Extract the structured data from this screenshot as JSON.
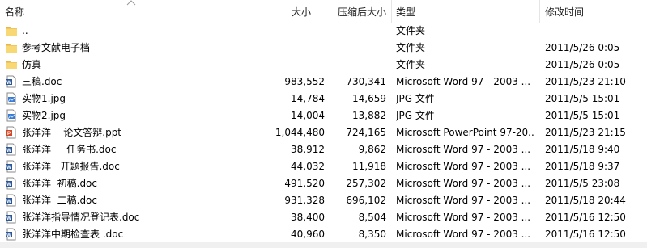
{
  "header": {
    "name": "名称",
    "size": "大小",
    "compressed_size": "压缩后大小",
    "type": "类型",
    "modified": "修改时间"
  },
  "files": [
    {
      "icon": "parent-folder-icon",
      "name": "..",
      "size": "",
      "compressed_size": "",
      "type": "文件夹",
      "modified": ""
    },
    {
      "icon": "folder-icon",
      "name": "参考文献电子档",
      "size": "",
      "compressed_size": "",
      "type": "文件夹",
      "modified": "2011/5/26 0:05"
    },
    {
      "icon": "folder-icon",
      "name": "仿真",
      "size": "",
      "compressed_size": "",
      "type": "文件夹",
      "modified": "2011/5/26 0:05"
    },
    {
      "icon": "word-doc-icon",
      "name": "三稿.doc",
      "size": "983,552",
      "compressed_size": "730,341",
      "type": "Microsoft Word 97 - 2003 ...",
      "modified": "2011/5/23 21:10"
    },
    {
      "icon": "jpg-image-icon",
      "name": "实物1.jpg",
      "size": "14,784",
      "compressed_size": "14,659",
      "type": "JPG 文件",
      "modified": "2011/5/5 15:01"
    },
    {
      "icon": "jpg-image-icon",
      "name": "实物2.jpg",
      "size": "14,004",
      "compressed_size": "13,882",
      "type": "JPG 文件",
      "modified": "2011/5/5 15:01"
    },
    {
      "icon": "powerpoint-icon",
      "name": "张洋洋    论文答辩.ppt",
      "size": "1,044,480",
      "compressed_size": "724,165",
      "type": "Microsoft PowerPoint 97-20...",
      "modified": "2011/5/23 21:15"
    },
    {
      "icon": "word-doc-icon",
      "name": "张洋洋     任务书.doc",
      "size": "38,912",
      "compressed_size": "9,862",
      "type": "Microsoft Word 97 - 2003 ...",
      "modified": "2011/5/18 9:40"
    },
    {
      "icon": "word-doc-icon",
      "name": "张洋洋   开题报告.doc",
      "size": "44,032",
      "compressed_size": "11,918",
      "type": "Microsoft Word 97 - 2003 ...",
      "modified": "2011/5/18 9:37"
    },
    {
      "icon": "word-doc-icon",
      "name": "张洋洋  初稿.doc",
      "size": "491,520",
      "compressed_size": "257,302",
      "type": "Microsoft Word 97 - 2003 ...",
      "modified": "2011/5/5 23:08"
    },
    {
      "icon": "word-doc-icon",
      "name": "张洋洋  二稿.doc",
      "size": "931,328",
      "compressed_size": "696,102",
      "type": "Microsoft Word 97 - 2003 ...",
      "modified": "2011/5/18 20:44"
    },
    {
      "icon": "word-doc-icon",
      "name": "张洋洋指导情况登记表.doc",
      "size": "38,400",
      "compressed_size": "8,504",
      "type": "Microsoft Word 97 - 2003 ...",
      "modified": "2011/5/16 12:50"
    },
    {
      "icon": "word-doc-icon",
      "name": "张洋洋中期检查表 .doc",
      "size": "40,960",
      "compressed_size": "8,350",
      "type": "Microsoft Word 97 - 2003 ...",
      "modified": "2011/5/16 12:50"
    }
  ],
  "colors": {
    "folder": "#f8d775",
    "folder_dark": "#e8b64a",
    "word_blue": "#2b5797",
    "ppt_red": "#d24726",
    "jpg_blue": "#3a7bd5",
    "divider": "#e5e5e5"
  }
}
